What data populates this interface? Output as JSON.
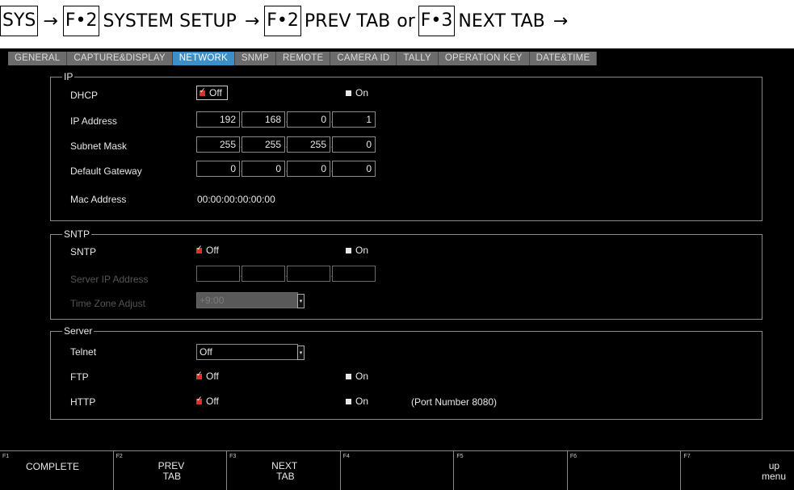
{
  "breadcrumb": {
    "sys": "SYS",
    "arrow": "→",
    "f2_key": "F•2",
    "system_setup": "SYSTEM SETUP",
    "prev_key": "F•2",
    "prev_tab": "PREV TAB",
    "or": "or",
    "next_key": "F•3",
    "next_tab": "NEXT TAB"
  },
  "tabs": [
    {
      "label": "GENERAL"
    },
    {
      "label": "CAPTURE&DISPLAY"
    },
    {
      "label": "NETWORK",
      "active": true
    },
    {
      "label": "SNMP"
    },
    {
      "label": "REMOTE"
    },
    {
      "label": "CAMERA ID"
    },
    {
      "label": "TALLY"
    },
    {
      "label": "OPERATION KEY"
    },
    {
      "label": "DATE&TIME"
    }
  ],
  "ip": {
    "title": "IP",
    "dhcp_label": "DHCP",
    "off": "Off",
    "on": "On",
    "ip_address_label": "IP Address",
    "ip_address": [
      "192",
      "168",
      "0",
      "1"
    ],
    "subnet_mask_label": "Subnet Mask",
    "subnet_mask": [
      "255",
      "255",
      "255",
      "0"
    ],
    "default_gateway_label": "Default Gateway",
    "default_gateway": [
      "0",
      "0",
      "0",
      "0"
    ],
    "mac_address_label": "Mac Address",
    "mac_address": "00:00:00:00:00:00",
    "dot": "."
  },
  "sntp": {
    "title": "SNTP",
    "sntp_label": "SNTP",
    "off": "Off",
    "on": "On",
    "server_ip_label": "Server IP Address",
    "server_ip": [
      "",
      "",
      "",
      ""
    ],
    "time_zone_label": "Time Zone Adjust",
    "time_zone_value": "+9:00"
  },
  "server": {
    "title": "Server",
    "telnet_label": "Telnet",
    "telnet_value": "Off",
    "ftp_label": "FTP",
    "http_label": "HTTP",
    "off": "Off",
    "on": "On",
    "port_note": "(Port Number 8080)"
  },
  "fkeys": {
    "f1_num": "F1",
    "f1": "COMPLETE",
    "f2_num": "F2",
    "f2_a": "PREV",
    "f2_b": "TAB",
    "f3_num": "F3",
    "f3_a": "NEXT",
    "f3_b": "TAB",
    "f4_num": "F4",
    "f5_num": "F5",
    "f6_num": "F6",
    "f7_num": "F7",
    "f7_a": "up",
    "f7_b": "menu"
  },
  "colors": {
    "active_tab": "#3d8fc9",
    "checked": "#d8342c",
    "background": "#000000"
  }
}
